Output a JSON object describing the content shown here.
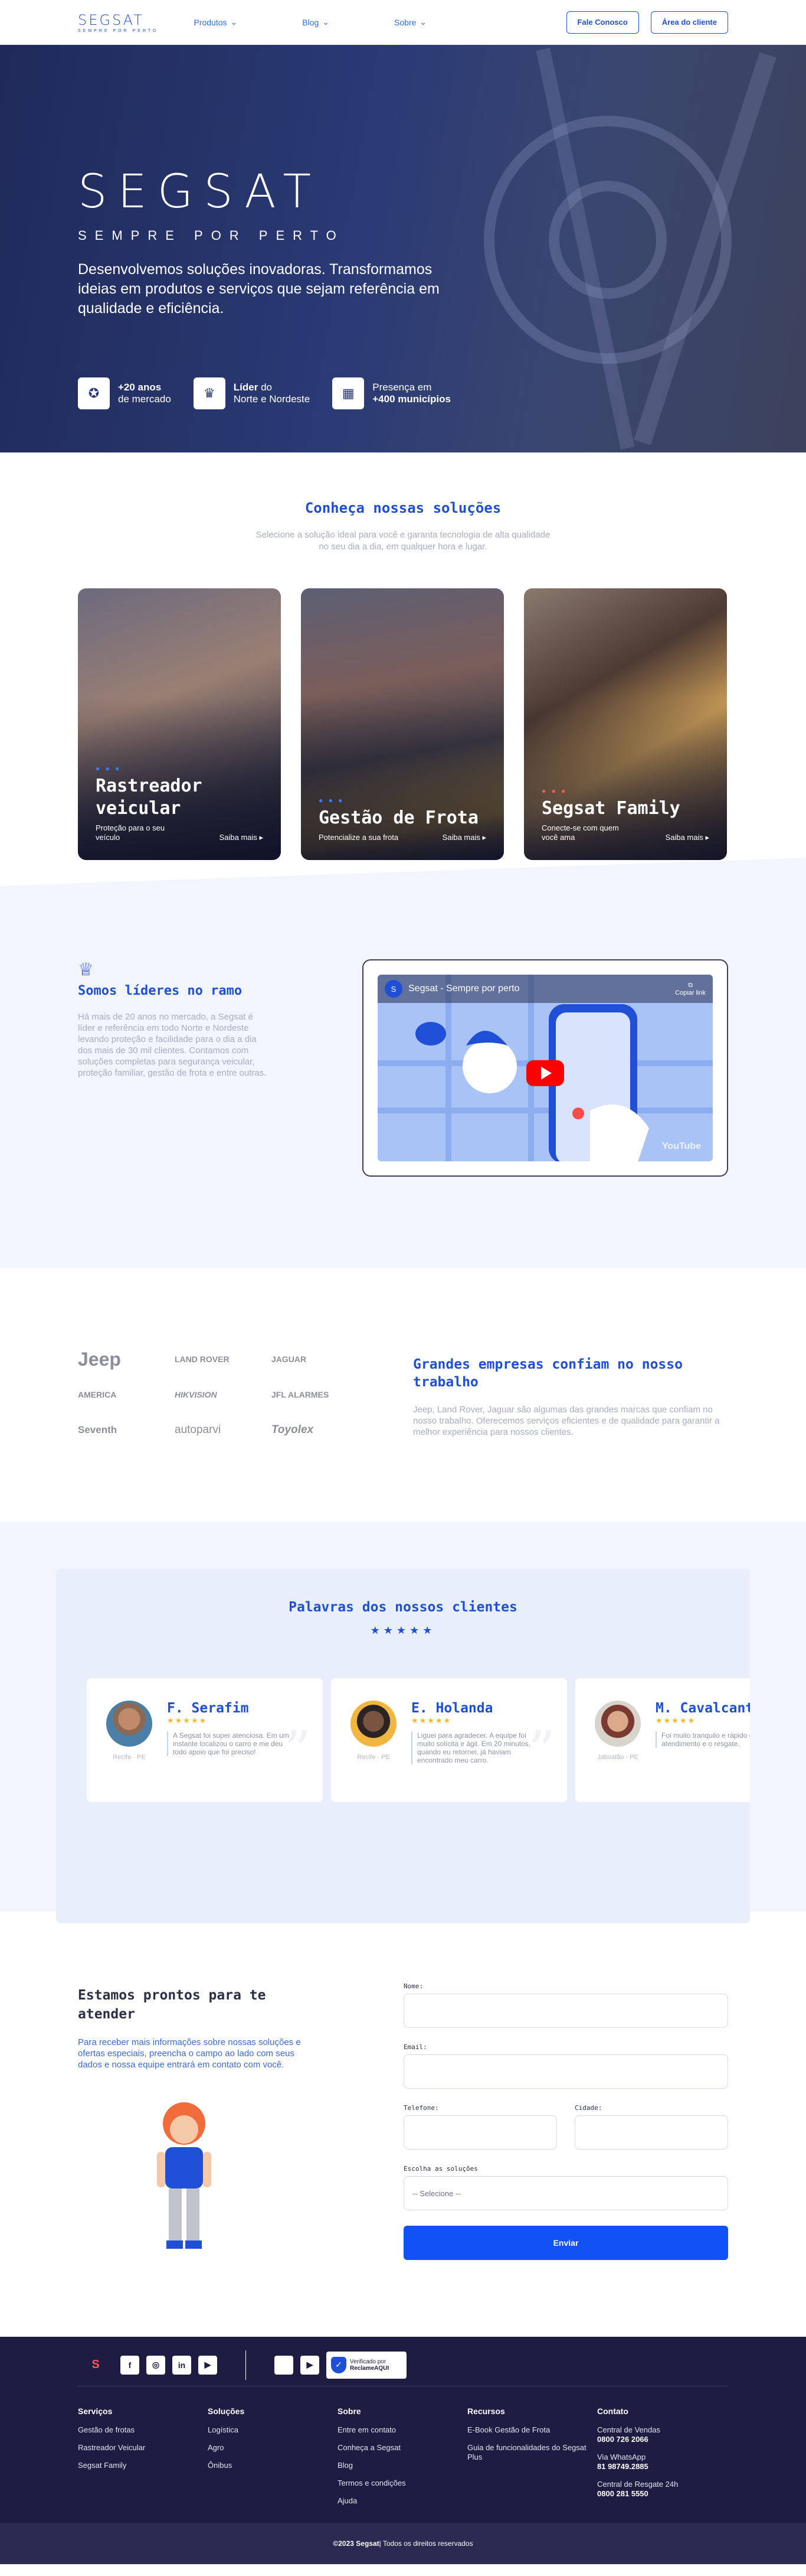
{
  "nav": {
    "logo": "SEGSAT",
    "logo_tag": "SEMPRE POR PERTO",
    "links": [
      "Produtos",
      "Blog",
      "Sobre"
    ],
    "contact_button": "Fale Conosco",
    "client_button": "Área do cliente"
  },
  "hero": {
    "title": "SEGSAT",
    "subtitle": "SEMPRE POR PERTO",
    "text": "Desenvolvemos soluções inovadoras. Transformamos ideias em produtos e serviços que sejam referência em qualidade e eficiência.",
    "stats": [
      {
        "bold": "+20 anos",
        "rest": "de mercado",
        "icon": "medal-icon"
      },
      {
        "bold": "Líder",
        "rest_inline": " do",
        "rest": "Norte e Nordeste",
        "icon": "trophy-icon"
      },
      {
        "pre": "Presença em",
        "bold": "+400 municípios",
        "icon": "map-icon"
      }
    ]
  },
  "solutions": {
    "title": "Conheça nossas soluções",
    "desc": "Selecione a solução ideal para você e garanta tecnologia de alta qualidade no seu dia a dia, em qualquer hora e lugar.",
    "cards": [
      {
        "title": "Rastreador veicular",
        "desc": "Proteção para o seu veículo",
        "link": "Saiba mais ▸",
        "dots": "● ● ●"
      },
      {
        "title": "Gestão de Frota",
        "desc": "Potencialize a sua frota",
        "link": "Saiba mais ▸",
        "dots": "● ● ●"
      },
      {
        "title": "Segsat Family",
        "desc": "Conecte-se com quem você ama",
        "link": "Saiba mais ▸",
        "dots": "● ● ●"
      }
    ]
  },
  "leaders": {
    "title": "Somos líderes no ramo",
    "text": "Há mais de 20 anos no mercado, a Segsat é líder e referência em todo Norte e Nordeste levando proteção e facilidade para o dia a dia dos mais de 30 mil clientes. Contamos com soluções completas para segurança veicular, proteção familiar, gestão de frota e entre outras.",
    "video_title": "Segsat - Sempre por perto",
    "video_copy": "Copiar link",
    "video_brand": "YouTube",
    "channel_initial": "S"
  },
  "brands": {
    "logos": [
      "Jeep",
      "LAND ROVER",
      "JAGUAR",
      "AMERICA",
      "HIKVISION",
      "JFL ALARMES",
      "Seventh",
      "autoparvi",
      "Toyolex"
    ],
    "title": "Grandes empresas confiam no nosso trabalho",
    "text": "Jeep, Land Rover, Jaguar são algumas das grandes marcas que confiam no nosso trabalho. Oferecemos serviços eficientes e de qualidade para garantir a melhor experiência para nossos clientes."
  },
  "testimonials": {
    "title": "Palavras dos nossos clientes",
    "stars": "★★★★★",
    "items": [
      {
        "name": "F. Serafim",
        "city": "Recife - PE",
        "stars": "★★★★★",
        "text": "A Segsat foi super atenciosa. Em um instante localizou o carro e me deu todo apoio que foi preciso!"
      },
      {
        "name": "E. Holanda",
        "city": "Recife - PE",
        "stars": "★★★★★",
        "text": "Liguei para agradecer. A equipe foi muito solícita e ágil. Em 20 minutos, quando eu retornei, já haviam encontrado meu carro."
      },
      {
        "name": "M. Cavalcanti",
        "city": "Jaboatão - PE",
        "stars": "★★★★★",
        "text": "Foi muito tranquilo e rápido o atendimento e o resgate."
      }
    ]
  },
  "contact": {
    "title": "Estamos prontos para te atender",
    "text": "Para receber mais informações sobre nossas soluções e ofertas especiais, preencha o campo ao lado com seus dados e nossa equipe entrará em contato com você.",
    "labels": {
      "name": "Nome:",
      "email": "Email:",
      "phone": "Telefone:",
      "city": "Cidade:",
      "solution": "Escolha as soluções"
    },
    "select_placeholder": "-- Selecione --",
    "send": "Enviar"
  },
  "footer": {
    "logo": "S",
    "socials": [
      "f",
      "◎",
      "in",
      "▶"
    ],
    "stores": [
      "",
      "▶"
    ],
    "badge_line1": "Verificado por",
    "badge_line2": "ReclameAQUI",
    "cols": [
      {
        "title": "Serviços",
        "items": [
          "Gestão de frotas",
          "Rastreador Veicular",
          "Segsat Family"
        ]
      },
      {
        "title": "Soluções",
        "items": [
          "Logística",
          "Agro",
          "Ônibus"
        ]
      },
      {
        "title": "Sobre",
        "items": [
          "Entre em contato",
          "Conheça a Segsat",
          "Blog",
          "Termos e condições",
          "Ajuda"
        ]
      },
      {
        "title": "Recursos",
        "items": [
          "E-Book Gestão de Frota",
          "Guia de funcionalidades do Segsat Plus"
        ]
      },
      {
        "title": "Contato",
        "items": [
          {
            "label": "Central de Vendas",
            "value": "0800 726 2066"
          },
          {
            "label": "Via WhatsApp",
            "value": "81 98749.2885"
          },
          {
            "label": "Central de Resgate 24h",
            "value": "0800 281 5550"
          }
        ]
      }
    ],
    "copyright_bold": "©2023 Segsat",
    "copyright_rest": " | Todos os direitos reservados"
  },
  "colors": {
    "primary": "#1f4fd6",
    "send": "#1151f5",
    "footer": "#1e1c42",
    "star": "#f2b630"
  }
}
